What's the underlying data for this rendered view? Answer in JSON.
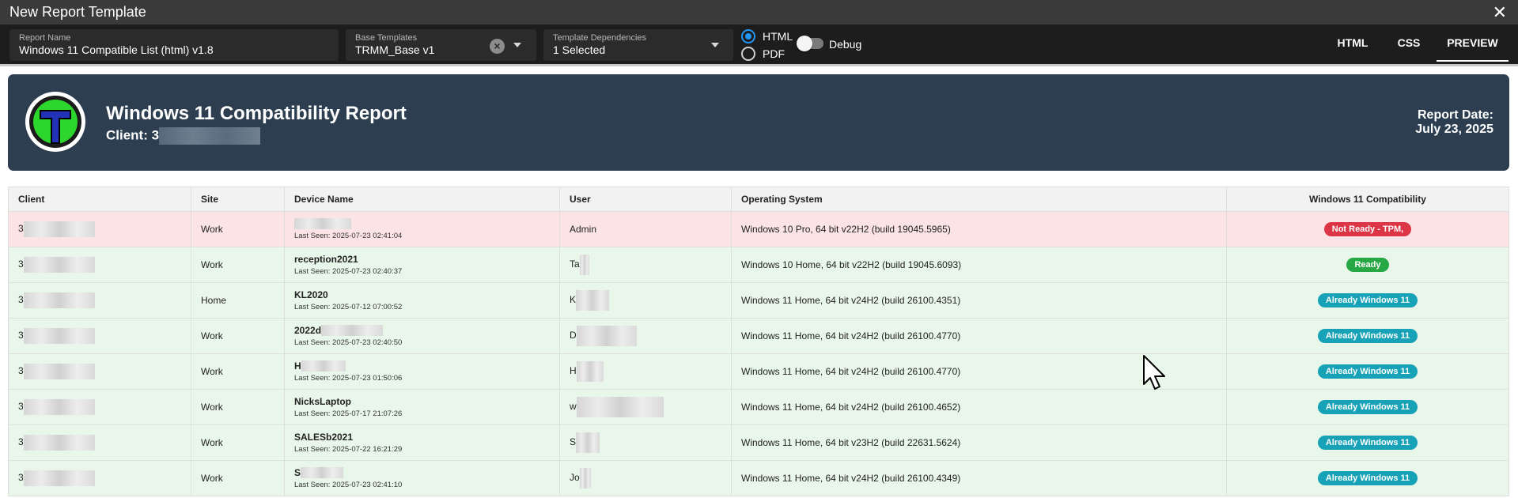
{
  "window": {
    "title": "New Report Template"
  },
  "toolbar": {
    "report_name": {
      "label": "Report Name",
      "value": "Windows 11 Compatible List (html) v1.8"
    },
    "base_templates": {
      "label": "Base Templates",
      "value": "TRMM_Base v1"
    },
    "dependencies": {
      "label": "Template Dependencies",
      "value": "1 Selected"
    },
    "format_html": "HTML",
    "format_pdf": "PDF",
    "debug": "Debug",
    "tabs": [
      "HTML",
      "CSS",
      "PREVIEW"
    ]
  },
  "report": {
    "title": "Windows 11 Compatibility Report",
    "client_prefix": "Client: 3",
    "date_label": "Report Date:",
    "date_value": "July 23, 2025"
  },
  "table": {
    "headers": [
      "Client",
      "Site",
      "Device Name",
      "User",
      "Operating System",
      "Windows 11 Compatibility"
    ],
    "rows": [
      {
        "client": "3",
        "site": "Work",
        "device": "",
        "seen": "Last Seen: 2025-07-23 02:41:04",
        "user": "Admin",
        "os": "Windows 10 Pro, 64 bit v22H2 (build 19045.5965)",
        "status": "Not Ready - TPM,",
        "status_color": "#dc3545",
        "row": "red"
      },
      {
        "client": "3",
        "site": "Work",
        "device": "reception2021",
        "seen": "Last Seen: 2025-07-23 02:40:37",
        "user": "Ta",
        "os": "Windows 10 Home, 64 bit v22H2 (build 19045.6093)",
        "status": "Ready",
        "status_color": "#28a745",
        "row": "green"
      },
      {
        "client": "3",
        "site": "Home",
        "device": "KL2020",
        "seen": "Last Seen: 2025-07-12 07:00:52",
        "user": "K",
        "os": "Windows 11 Home, 64 bit v24H2 (build 26100.4351)",
        "status": "Already Windows 11",
        "status_color": "#17a2b8",
        "row": "green"
      },
      {
        "client": "3",
        "site": "Work",
        "device": "2022d",
        "seen": "Last Seen: 2025-07-23 02:40:50",
        "user": "D",
        "os": "Windows 11 Home, 64 bit v24H2 (build 26100.4770)",
        "status": "Already Windows 11",
        "status_color": "#17a2b8",
        "row": "green"
      },
      {
        "client": "3",
        "site": "Work",
        "device": "H",
        "seen": "Last Seen: 2025-07-23 01:50:06",
        "user": "H",
        "os": "Windows 11 Home, 64 bit v24H2 (build 26100.4770)",
        "status": "Already Windows 11",
        "status_color": "#17a2b8",
        "row": "green"
      },
      {
        "client": "3",
        "site": "Work",
        "device": "NicksLaptop",
        "seen": "Last Seen: 2025-07-17 21:07:26",
        "user": "w",
        "os": "Windows 11 Home, 64 bit v24H2 (build 26100.4652)",
        "status": "Already Windows 11",
        "status_color": "#17a2b8",
        "row": "green"
      },
      {
        "client": "3",
        "site": "Work",
        "device": "SALESb2021",
        "seen": "Last Seen: 2025-07-22 16:21:29",
        "user": "S",
        "os": "Windows 11 Home, 64 bit v23H2 (build 22631.5624)",
        "status": "Already Windows 11",
        "status_color": "#17a2b8",
        "row": "green"
      },
      {
        "client": "3",
        "site": "Work",
        "device": "S",
        "seen": "Last Seen: 2025-07-23 02:41:10",
        "user": "Jo",
        "os": "Windows 11 Home, 64 bit v24H2 (build 26100.4349)",
        "status": "Already Windows 11",
        "status_color": "#17a2b8",
        "row": "green"
      }
    ]
  },
  "icons": {
    "close": "close-icon",
    "clear": "clear-icon",
    "caret": "chevron-down-icon",
    "cursor": "mouse-cursor-icon"
  }
}
